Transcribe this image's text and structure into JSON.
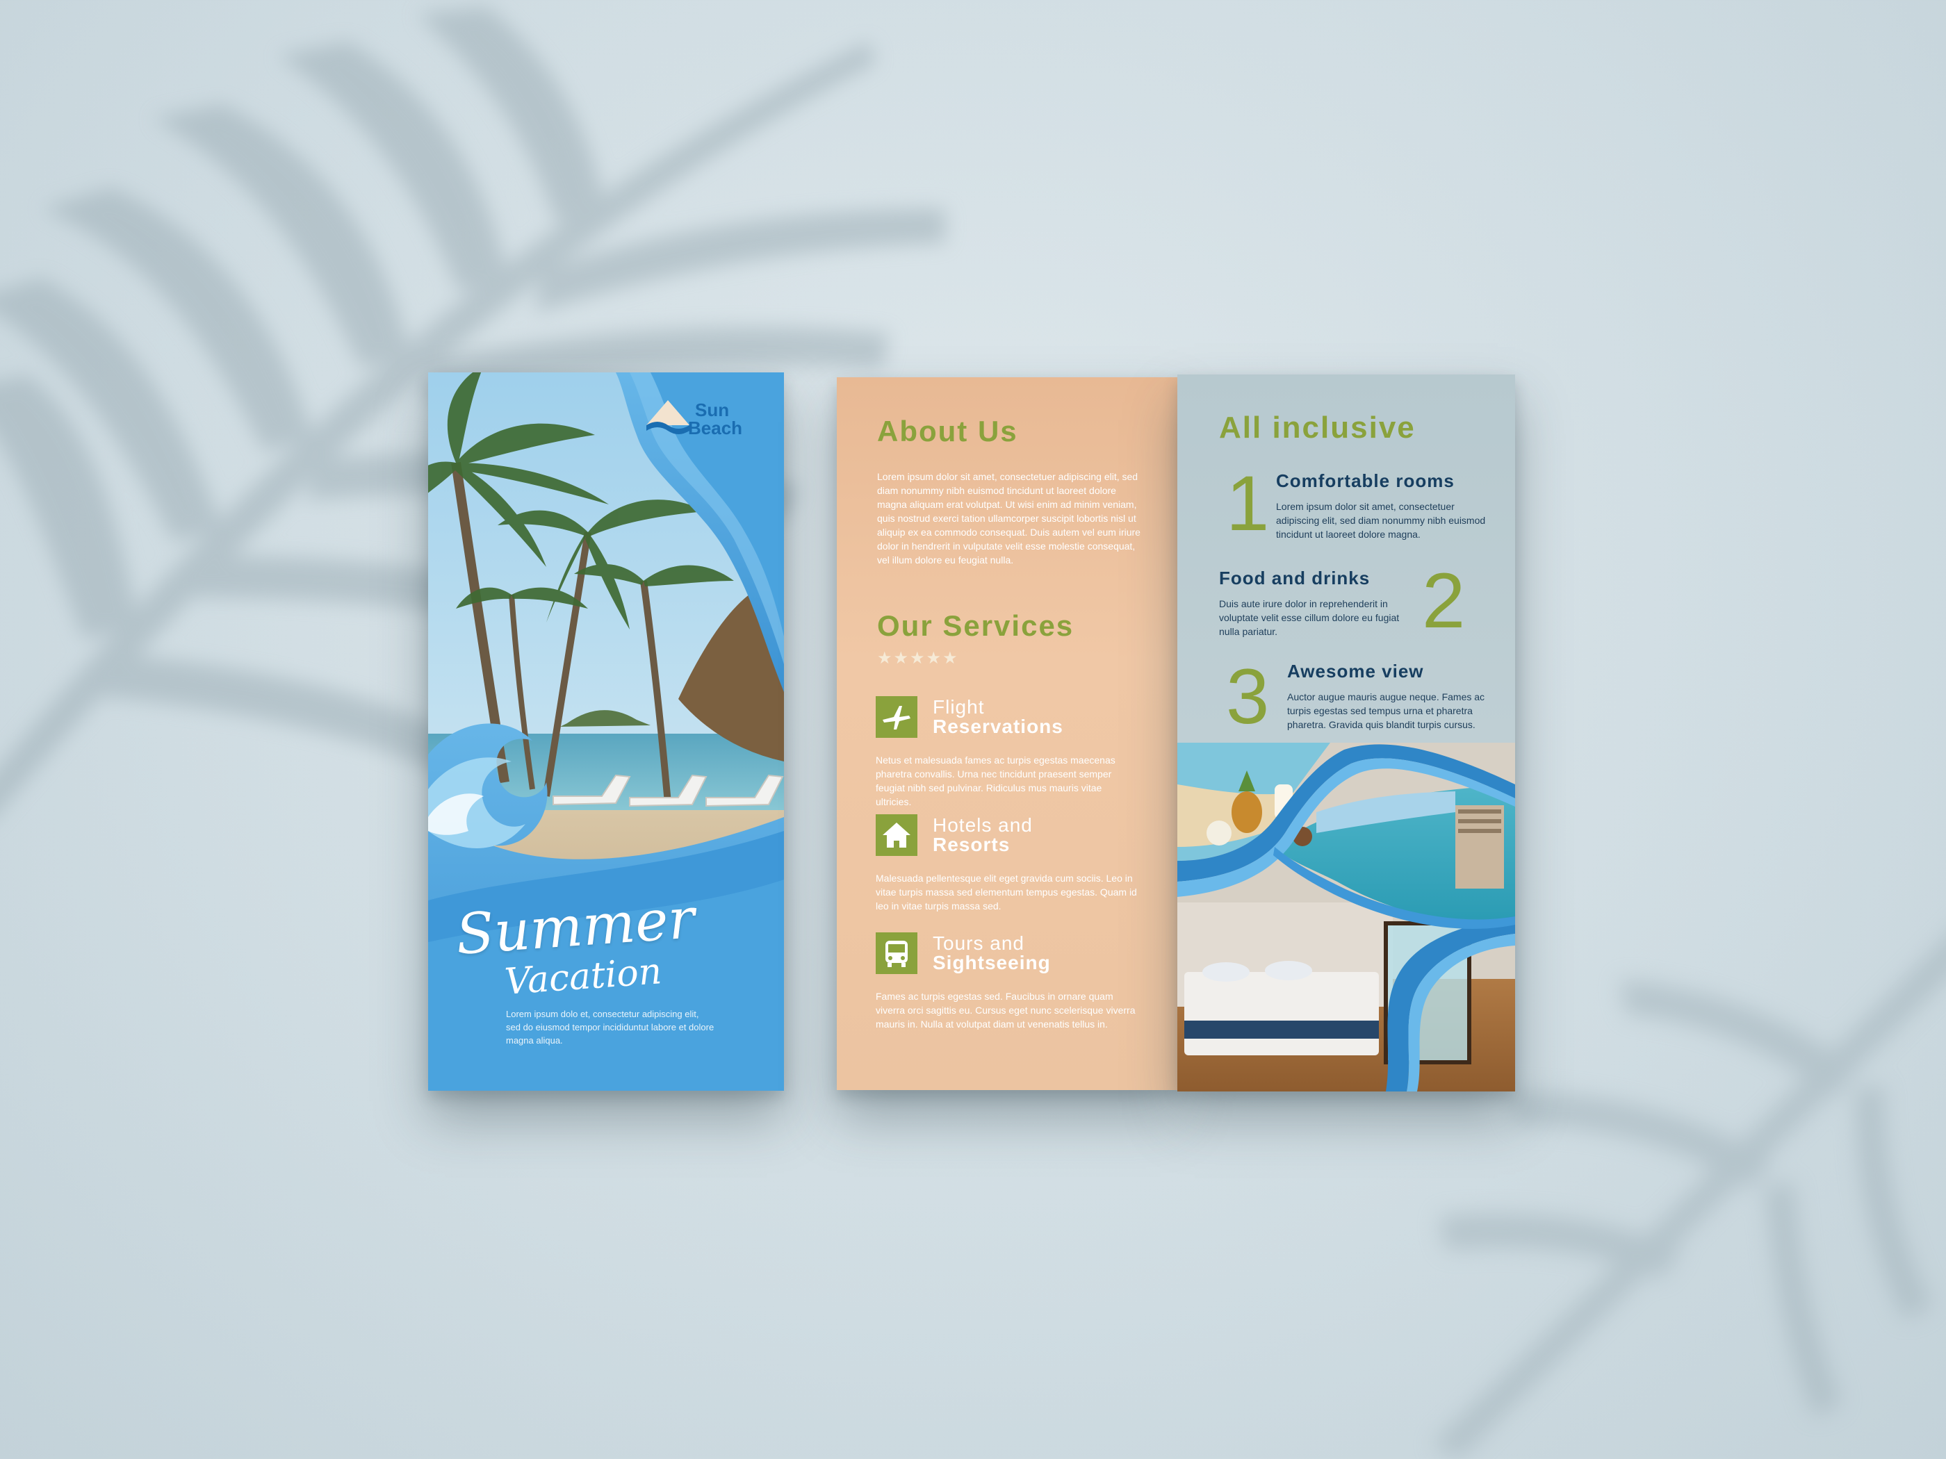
{
  "cover": {
    "logo": {
      "line1": "Sun",
      "line2": "Beach"
    },
    "title": "Summer",
    "subtitle": "Vacation",
    "text": "Lorem ipsum dolo et, consectetur adipiscing elit, sed do eiusmod tempor incididuntut labore et dolore magna aliqua."
  },
  "inside_left": {
    "about_heading": "About Us",
    "about_text": "Lorem ipsum dolor sit amet, consectetuer adipiscing elit, sed diam nonummy nibh euismod tincidunt ut laoreet dolore magna aliquam erat volutpat. Ut wisi enim ad minim veniam, quis nostrud exerci tation ullamcorper suscipit lobortis nisl ut aliquip ex ea commodo consequat. Duis autem vel eum iriure dolor in hendrerit in vulputate velit esse molestie consequat, vel illum dolore eu feugiat nulla.",
    "services_heading": "Our Services",
    "stars": "★★★★★",
    "services": [
      {
        "icon": "airplane-icon",
        "line1": "Flight",
        "line2": "Reservations",
        "text": "Netus et malesuada fames ac turpis egestas maecenas pharetra convallis. Urna nec tincidunt praesent semper feugiat nibh sed pulvinar. Ridiculus mus mauris vitae ultricies."
      },
      {
        "icon": "house-icon",
        "line1": "Hotels and",
        "line2": "Resorts",
        "text": "Malesuada pellentesque elit eget gravida cum sociis. Leo in vitae turpis massa sed elementum tempus egestas. Quam id leo in vitae turpis massa sed."
      },
      {
        "icon": "bus-icon",
        "line1": "Tours and",
        "line2": "Sightseeing",
        "text": "Fames ac turpis egestas sed. Faucibus in ornare quam viverra orci sagittis eu. Cursus eget nunc scelerisque viverra mauris in. Nulla at volutpat diam ut venenatis tellus in."
      }
    ]
  },
  "inside_right": {
    "heading": "All inclusive",
    "items": [
      {
        "number": "1",
        "title": "Comfortable rooms",
        "text": "Lorem ipsum dolor sit amet, consectetuer adipiscing elit, sed diam nonummy nibh euismod tincidunt ut laoreet dolore magna."
      },
      {
        "number": "2",
        "title": "Food and drinks",
        "text": "Duis aute irure dolor in reprehenderit in voluptate velit esse cillum dolore eu fugiat nulla pariatur."
      },
      {
        "number": "3",
        "title": "Awesome view",
        "text": "Auctor augue mauris augue neque. Fames ac turpis egestas sed tempus urna et pharetra pharetra. Gravida quis blandit turpis cursus."
      }
    ]
  },
  "colors": {
    "accent_green": "#8aa23c",
    "brand_blue": "#4aa3de",
    "peach": "#ecc4a1",
    "slate": "#bfcfd4"
  }
}
